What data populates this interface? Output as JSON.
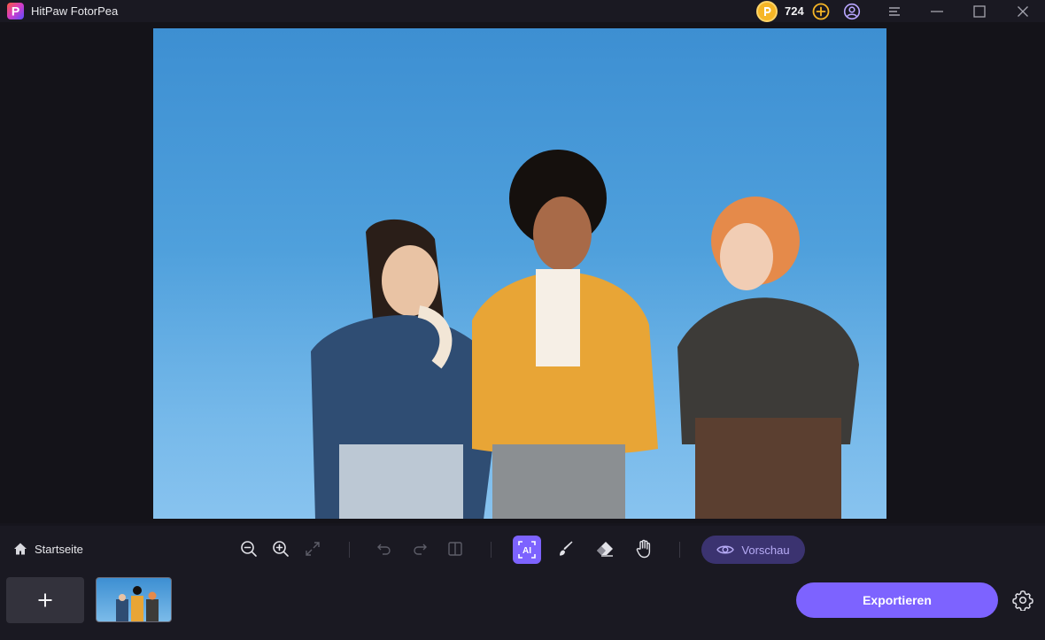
{
  "app": {
    "title": "HitPaw FotorPea",
    "logo_letter": "P"
  },
  "titlebar": {
    "coins": "724",
    "icons": [
      "coin-icon",
      "add-coins-icon",
      "account-icon",
      "menu-icon",
      "minimize-icon",
      "maximize-icon",
      "close-icon"
    ]
  },
  "toolbar": {
    "home_label": "Startseite",
    "tools": [
      "zoom-out-icon",
      "zoom-in-icon",
      "fit-screen-icon",
      "undo-icon",
      "redo-icon",
      "compare-icon",
      "ai-select-icon",
      "brush-icon",
      "eraser-icon",
      "hand-icon"
    ],
    "ai_label": "AI",
    "preview_label": "Vorschau"
  },
  "bottombar": {
    "export_label": "Exportieren"
  },
  "colors": {
    "accent": "#7d63ff",
    "preview_bg": "#3b3370",
    "coin": "#f6b626"
  }
}
